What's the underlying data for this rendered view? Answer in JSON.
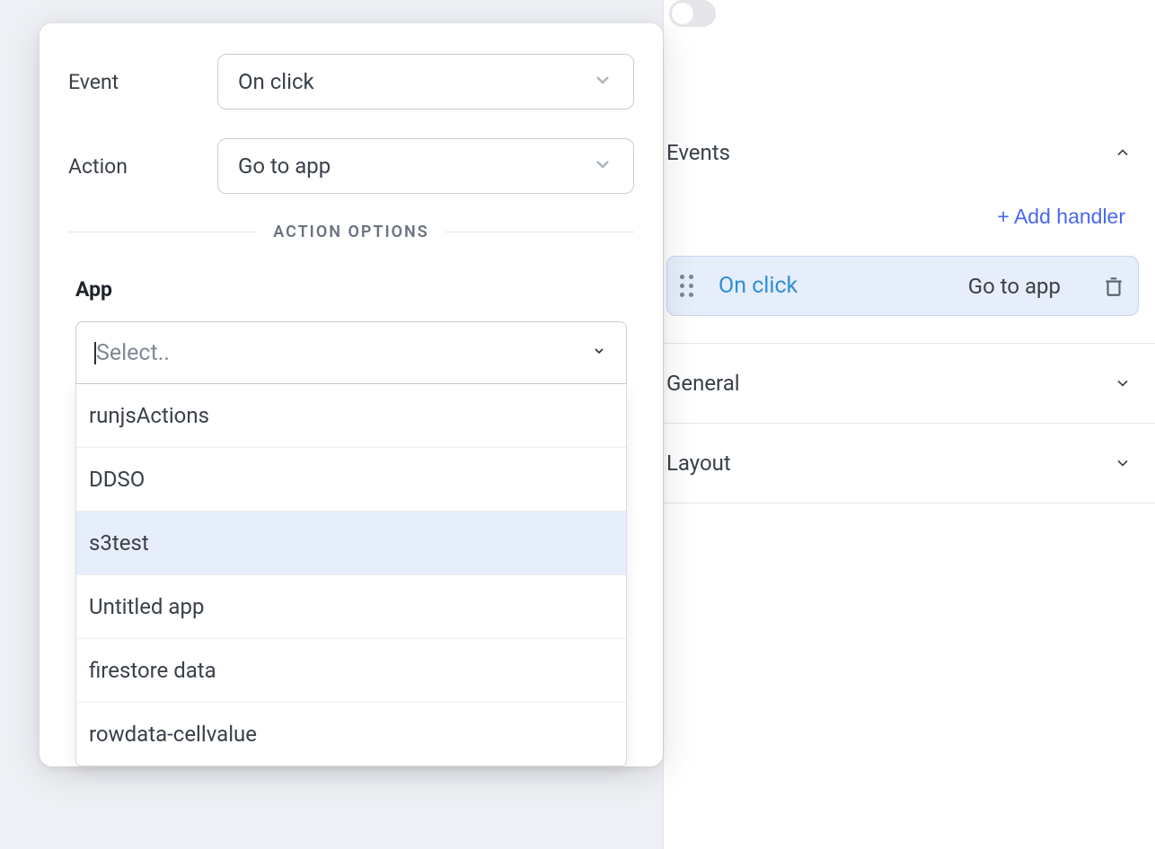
{
  "popup": {
    "event": {
      "label": "Event",
      "value": "On click"
    },
    "action": {
      "label": "Action",
      "value": "Go to app"
    },
    "divider_label": "ACTION OPTIONS",
    "app": {
      "label": "App",
      "placeholder": "Select..",
      "options": [
        {
          "label": "runjsActions",
          "highlighted": false
        },
        {
          "label": "DDSO",
          "highlighted": false
        },
        {
          "label": "s3test",
          "highlighted": true
        },
        {
          "label": "Untitled app",
          "highlighted": false
        },
        {
          "label": "firestore data",
          "highlighted": false
        },
        {
          "label": "rowdata-cellvalue",
          "highlighted": false
        }
      ]
    }
  },
  "sidebar": {
    "sections": {
      "events": {
        "title": "Events",
        "expanded": true,
        "add_handler_label": "+ Add handler",
        "handlers": [
          {
            "event": "On click",
            "action": "Go to app"
          }
        ]
      },
      "general": {
        "title": "General",
        "expanded": false
      },
      "layout": {
        "title": "Layout",
        "expanded": false
      }
    }
  }
}
